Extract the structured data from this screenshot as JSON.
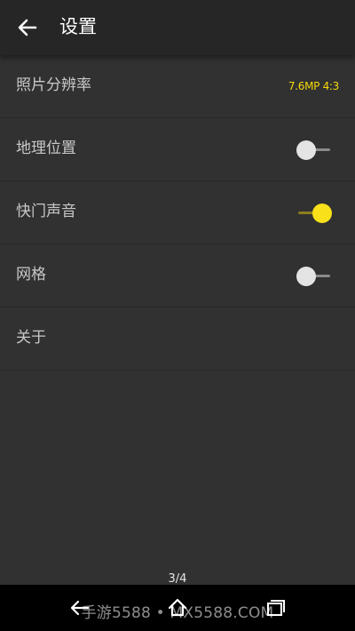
{
  "header": {
    "title": "设置"
  },
  "settings": {
    "items": [
      {
        "label": "照片分辨率",
        "value": "7.6MP 4:3"
      },
      {
        "label": "地理位置",
        "toggle": "off"
      },
      {
        "label": "快门声音",
        "toggle": "on"
      },
      {
        "label": "网格",
        "toggle": "off"
      },
      {
        "label": "关于"
      }
    ]
  },
  "footer": {
    "page_indicator": "3/4",
    "watermark": "手游5588 • MX5588.COM"
  },
  "colors": {
    "accent": "#f8e11a",
    "background": "#313131",
    "toolbar": "#262626"
  },
  "icons": [
    "back-arrow-icon",
    "nav-back-icon",
    "nav-home-icon",
    "nav-recent-apps-icon"
  ]
}
